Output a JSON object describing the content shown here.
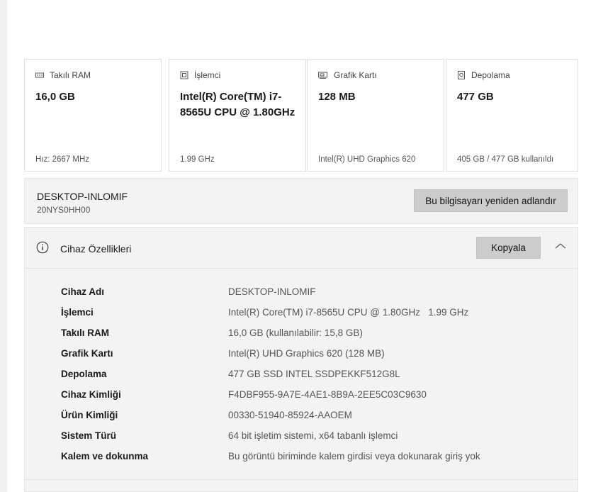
{
  "cards": [
    {
      "icon": "ram-icon",
      "label": "Takılı RAM",
      "value": "16,0 GB",
      "footer": "Hız: 2667 MHz"
    },
    {
      "icon": "processor-icon",
      "label": "İşlemci",
      "value": "Intel(R) Core(TM) i7-8565U CPU @ 1.80GHz",
      "footer": "1.99 GHz"
    },
    {
      "icon": "graphics-card-icon",
      "label": "Grafik Kartı",
      "value": "128 MB",
      "footer": "Intel(R) UHD Graphics 620"
    },
    {
      "icon": "storage-icon",
      "label": "Depolama",
      "value": "477 GB",
      "footer": "405 GB / 477 GB kullanıldı"
    }
  ],
  "pc": {
    "name": "DESKTOP-INLOMIF",
    "model": "20NYS0HH00",
    "rename_label": "Bu bilgisayarı yeniden adlandır"
  },
  "specs": {
    "title": "Cihaz Özellikleri",
    "copy_label": "Kopyala",
    "rows": [
      {
        "label": "Cihaz Adı",
        "value": "DESKTOP-INLOMIF"
      },
      {
        "label": "İşlemci",
        "value": "Intel(R) Core(TM) i7-8565U CPU @ 1.80GHz   1.99 GHz"
      },
      {
        "label": "Takılı RAM",
        "value": "16,0 GB (kullanılabilir: 15,8 GB)"
      },
      {
        "label": "Grafik Kartı",
        "value": "Intel(R) UHD Graphics 620 (128 MB)"
      },
      {
        "label": "Depolama",
        "value": "477 GB SSD INTEL SSDPEKKF512G8L"
      },
      {
        "label": "Cihaz Kimliği",
        "value": "F4DBF955-9A7E-4AE1-8B9A-2EE5C03C9630"
      },
      {
        "label": "Ürün Kimliği",
        "value": "00330-51940-85924-AAOEM"
      },
      {
        "label": "Sistem Türü",
        "value": "64 bit işletim sistemi, x64 tabanlı işlemci"
      },
      {
        "label": "Kalem ve dokunma",
        "value": "Bu görüntü biriminde kalem girdisi veya dokunarak giriş yok"
      }
    ]
  },
  "colors": {
    "accent": "#0067c0",
    "panel_bg": "#f3f3f3",
    "button_bg": "#cccccc"
  }
}
